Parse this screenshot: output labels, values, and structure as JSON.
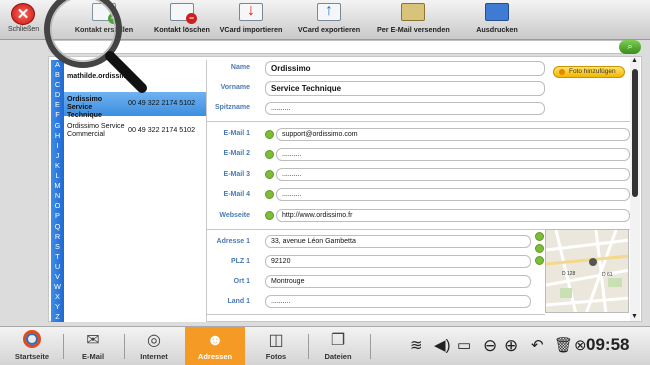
{
  "top": {
    "close_label": "Schließen",
    "close_icon": "close-icon",
    "buttons": [
      {
        "label": "Kontakt erstellen",
        "badge": "+"
      },
      {
        "label": "Kontakt löschen",
        "badge": "−"
      },
      {
        "label": "VCard importieren",
        "badge": "↓"
      },
      {
        "label": "VCard exportieren",
        "badge": "↑"
      },
      {
        "label": "Per E-Mail versenden",
        "badge": ""
      },
      {
        "label": "Ausdrucken",
        "badge": ""
      }
    ]
  },
  "search": {
    "value": ""
  },
  "alphabet": [
    "A",
    "B",
    "C",
    "D",
    "E",
    "F",
    "G",
    "H",
    "I",
    "J",
    "K",
    "L",
    "M",
    "N",
    "O",
    "P",
    "Q",
    "R",
    "S",
    "T",
    "U",
    "V",
    "W",
    "X",
    "Y",
    "Z"
  ],
  "contacts": [
    {
      "name": "mathilde.ordissimo",
      "phone": ""
    },
    {
      "name": "Ordissimo Service Technique",
      "phone": "00 49 322 2174 5102",
      "selected": true
    },
    {
      "name": "Ordissimo Service Commercial",
      "phone": "00 49 322 2174 5102"
    }
  ],
  "form": {
    "name": {
      "label": "Name",
      "value": "Ordissimo"
    },
    "vorname": {
      "label": "Vorname",
      "value": "Service Technique"
    },
    "spitzname": {
      "label": "Spitzname",
      "value": ".........."
    },
    "email1": {
      "label": "E-Mail 1",
      "value": "support@ordissimo.com"
    },
    "email2": {
      "label": "E-Mail 2",
      "value": ".........."
    },
    "email3": {
      "label": "E-Mail 3",
      "value": ".........."
    },
    "email4": {
      "label": "E-Mail 4",
      "value": ".........."
    },
    "webseite": {
      "label": "Webseite",
      "value": "http://www.ordissimo.fr"
    },
    "adresse1": {
      "label": "Adresse 1",
      "value": "33, avenue Léon Gambetta"
    },
    "plz1": {
      "label": "PLZ 1",
      "value": "92120"
    },
    "ort1": {
      "label": "Ort 1",
      "value": "Montrouge"
    },
    "land1": {
      "label": "Land 1",
      "value": ".........."
    },
    "foto_button": "Foto hinzufügen"
  },
  "map": {
    "label1": "D 128",
    "label2": "D 61"
  },
  "taskbar": {
    "items": [
      {
        "label": "Startseite",
        "icon": "ordissimo-logo-icon"
      },
      {
        "label": "E-Mail",
        "icon": "envelope-icon"
      },
      {
        "label": "Internet",
        "icon": "globe-icon"
      },
      {
        "label": "Adressen",
        "icon": "contacts-icon",
        "active": true
      },
      {
        "label": "Fotos",
        "icon": "camera-icon"
      },
      {
        "label": "Dateien",
        "icon": "files-icon"
      }
    ],
    "clock": "09:58"
  }
}
